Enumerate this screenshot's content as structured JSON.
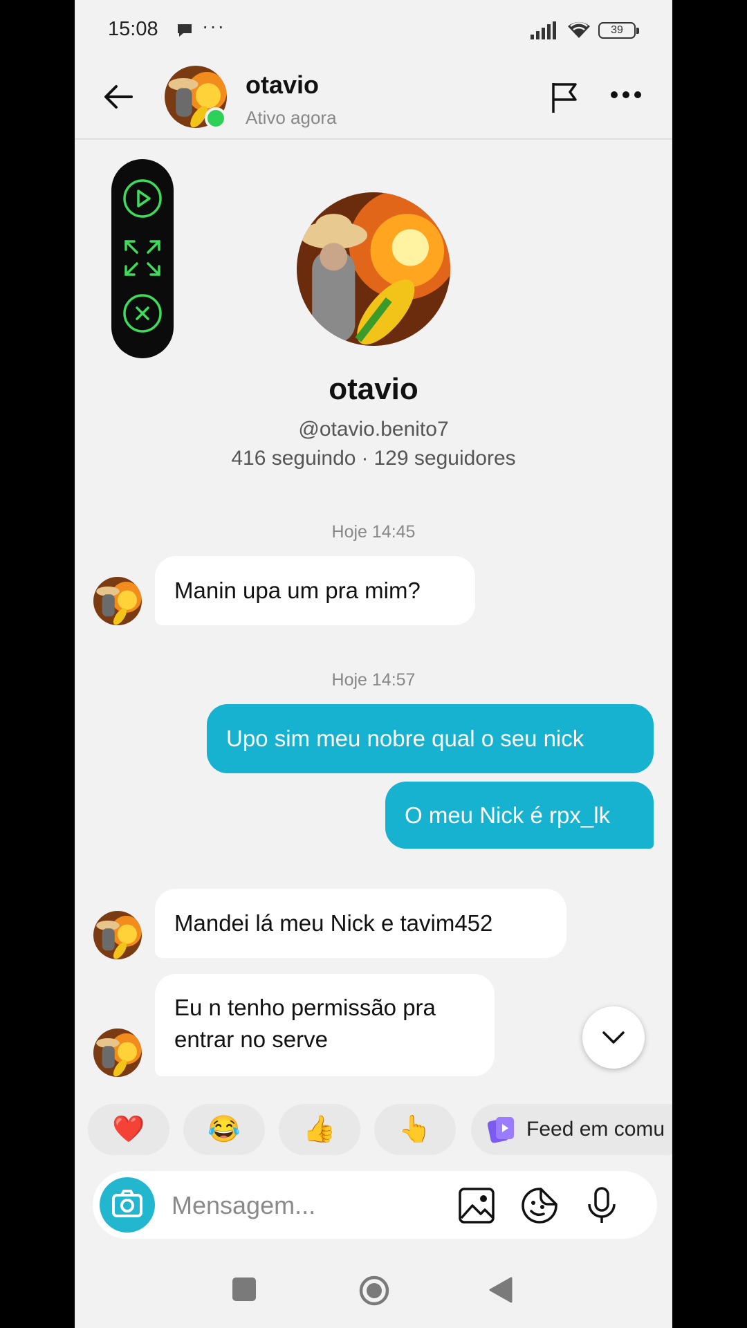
{
  "status_bar": {
    "time": "15:08",
    "more": "···",
    "battery": "39"
  },
  "header": {
    "name": "otavio",
    "status": "Ativo agora"
  },
  "profile": {
    "name": "otavio",
    "handle": "@otavio.benito7",
    "following": "416 seguindo",
    "separator": "·",
    "followers": "129 seguidores"
  },
  "messages": {
    "ts1": "Hoje 14:45",
    "m1": "Manin upa um pra mim?",
    "ts2": "Hoje 14:57",
    "m2": "Upo sim meu nobre qual o seu nick",
    "m3": "O meu Nick é rpx_lk",
    "m4": "Mandei lá meu Nick e tavim452",
    "m5_line1": "Eu n tenho permissão pra",
    "m5_line2": "entrar no serve"
  },
  "reactions": {
    "r1": "❤️",
    "r2": "😂",
    "r3": "👍",
    "r4": "👆",
    "feed": "Feed em comu"
  },
  "composer": {
    "placeholder": "Mensagem..."
  },
  "colors": {
    "outgoing_bubble": "#16b2cf",
    "online": "#2ed157",
    "pill_icon": "#3ddc5a"
  }
}
